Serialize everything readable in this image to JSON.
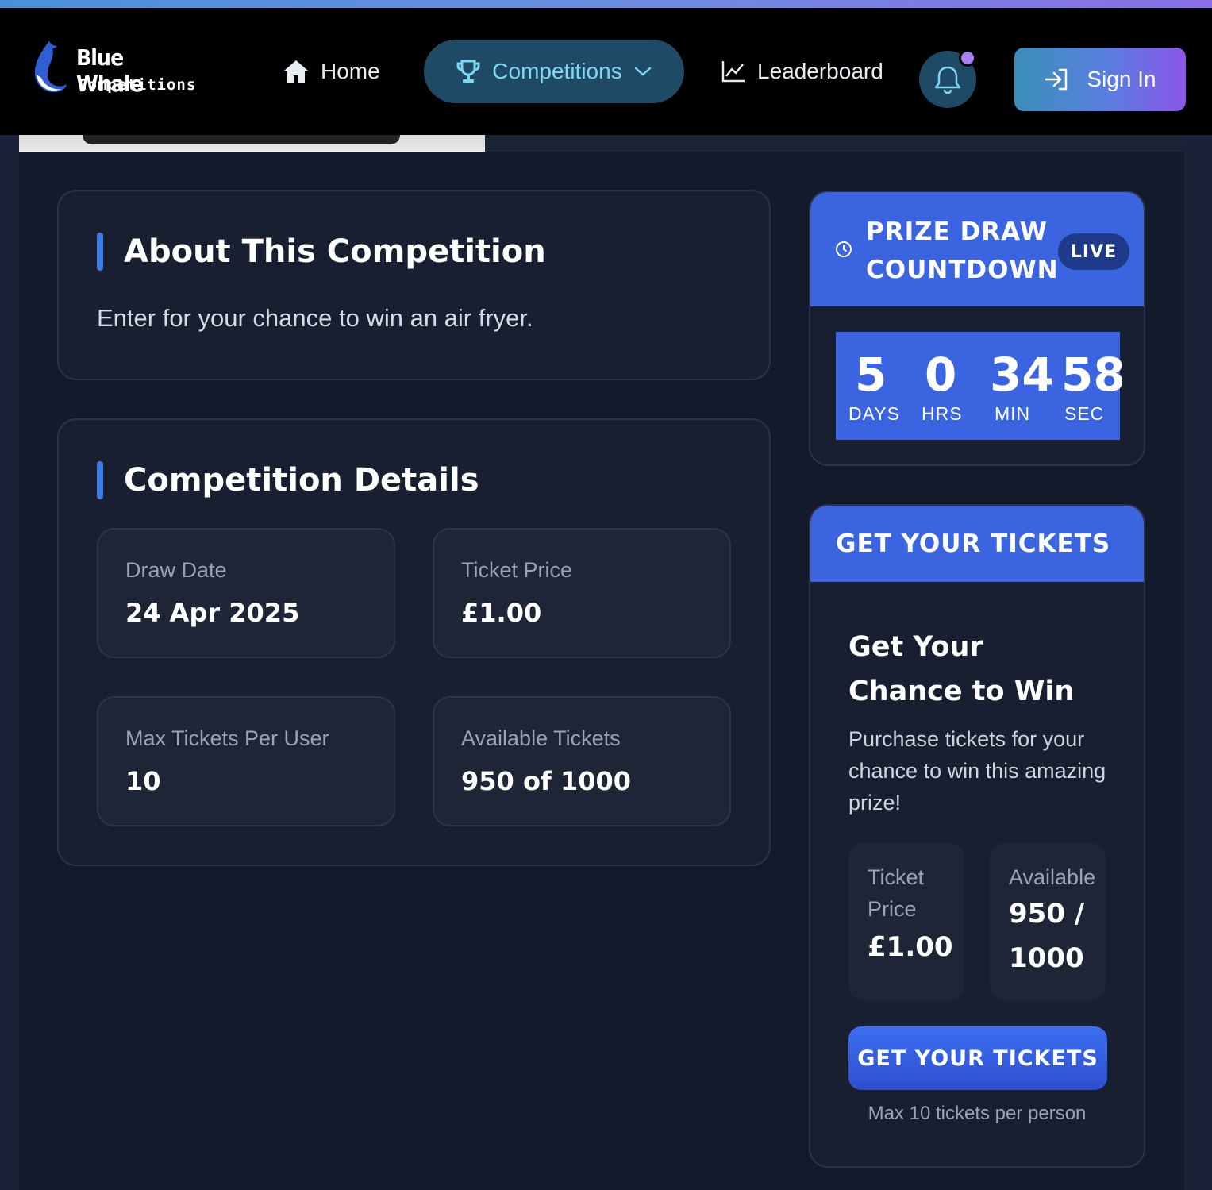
{
  "brand": {
    "name": "Blue Whale",
    "tagline": "Competitions"
  },
  "nav": {
    "home": "Home",
    "competitions": "Competitions",
    "leaderboard": "Leaderboard",
    "sign_in": "Sign In"
  },
  "about": {
    "title": "About This Competition",
    "text": "Enter for your chance to win an air fryer."
  },
  "details": {
    "title": "Competition Details",
    "items": [
      {
        "label": "Draw Date",
        "value": "24 Apr 2025"
      },
      {
        "label": "Ticket Price",
        "value": "£1.00"
      },
      {
        "label": "Max Tickets Per User",
        "value": "10"
      },
      {
        "label": "Available Tickets",
        "value": "950 of 1000"
      }
    ]
  },
  "countdown": {
    "title_line1": "PRIZE DRAW",
    "title_line2": "COUNTDOWN",
    "badge": "LIVE",
    "units": [
      {
        "value": "5",
        "label": "DAYS"
      },
      {
        "value": "0",
        "label": "HRS"
      },
      {
        "value": "34",
        "label": "MIN"
      },
      {
        "value": "58",
        "label": "SEC"
      }
    ]
  },
  "tickets": {
    "header": "GET YOUR TICKETS",
    "chance_title": "Get Your Chance to Win",
    "chance_text": "Purchase tickets for your chance to win this amazing prize!",
    "price_label_1": "Ticket",
    "price_label_2": "Price",
    "price_value": "£1.00",
    "available_label": "Available",
    "available_value_1": "950 /",
    "available_value_2": "1000",
    "button": "GET YOUR TICKETS",
    "note": "Max 10 tickets per person"
  },
  "colors": {
    "accent": "#3a64e0",
    "nav_active_bg": "#1e4a66",
    "nav_active_text": "#7fd6f2",
    "notification_dot": "#a77ff0"
  }
}
